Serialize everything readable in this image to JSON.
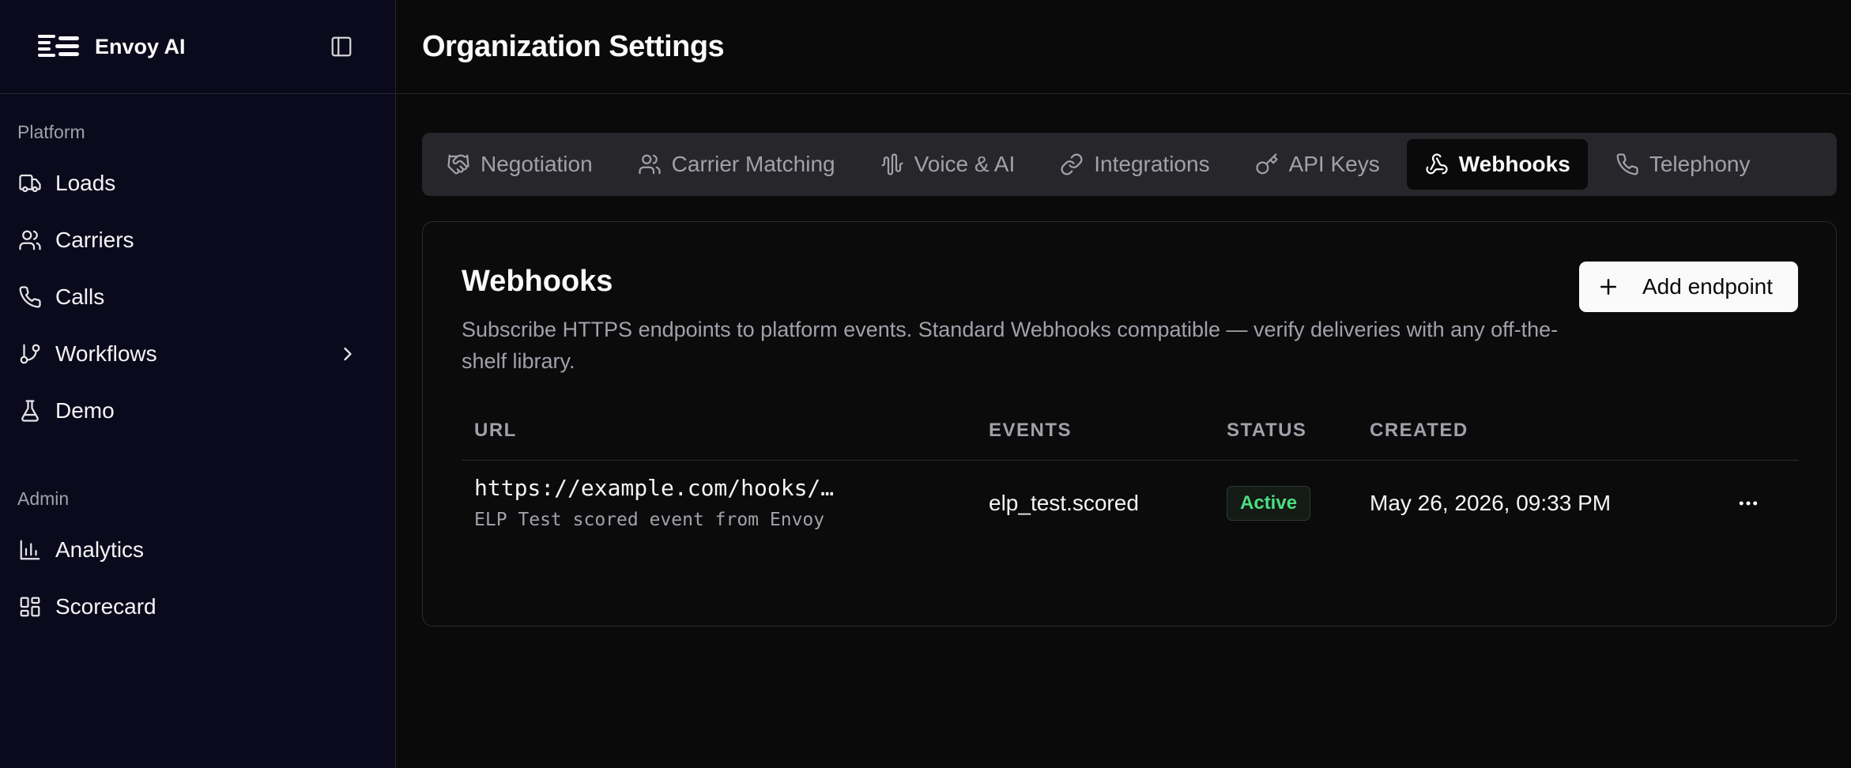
{
  "app": {
    "brand": "Envoy AI"
  },
  "sidebar": {
    "sections": [
      {
        "label": "Platform"
      },
      {
        "label": "Admin"
      }
    ],
    "items": [
      {
        "label": "Loads",
        "icon": "truck-icon"
      },
      {
        "label": "Carriers",
        "icon": "users-icon"
      },
      {
        "label": "Calls",
        "icon": "phone-icon"
      },
      {
        "label": "Workflows",
        "icon": "git-branch-icon"
      },
      {
        "label": "Demo",
        "icon": "flask-icon"
      },
      {
        "label": "Analytics",
        "icon": "bar-chart-icon"
      },
      {
        "label": "Scorecard",
        "icon": "layout-grid-icon"
      }
    ]
  },
  "header": {
    "title": "Organization Settings"
  },
  "tabs": [
    {
      "label": "Negotiation",
      "icon": "handshake-icon"
    },
    {
      "label": "Carrier Matching",
      "icon": "users-icon"
    },
    {
      "label": "Voice & AI",
      "icon": "audio-waveform-icon"
    },
    {
      "label": "Integrations",
      "icon": "link-icon"
    },
    {
      "label": "API Keys",
      "icon": "key-icon"
    },
    {
      "label": "Webhooks",
      "icon": "webhook-icon",
      "active": true
    },
    {
      "label": "Telephony",
      "icon": "phone-icon"
    }
  ],
  "webhooks": {
    "title": "Webhooks",
    "description": "Subscribe HTTPS endpoints to platform events. Standard Webhooks compatible — verify deliveries with any off-the-shelf library.",
    "add_label": "Add endpoint",
    "columns": [
      "URL",
      "EVENTS",
      "STATUS",
      "CREATED"
    ],
    "rows": [
      {
        "url": "https://example.com/hooks/…",
        "description": "ELP Test scored event from Envoy",
        "events": "elp_test.scored",
        "status": "Active",
        "created": "May 26, 2026, 09:33 PM"
      }
    ]
  },
  "colors": {
    "sidebar_bg": "#0b0a1c",
    "main_bg": "#0a0a0b",
    "active_status": "#4ade80"
  }
}
